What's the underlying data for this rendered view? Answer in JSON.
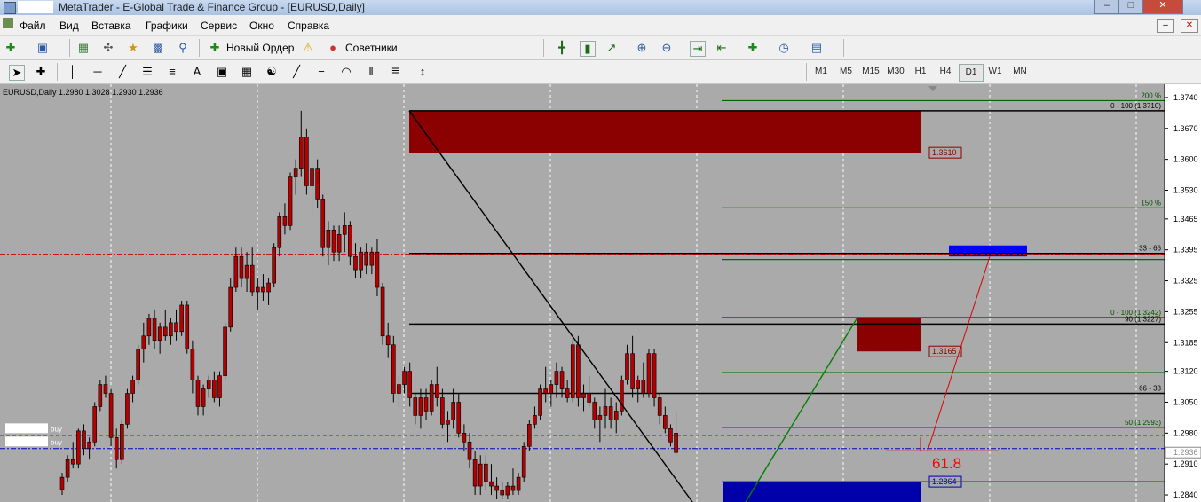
{
  "window": {
    "title": "MetaTrader - E-Global Trade & Finance Group - [EURUSD,Daily]"
  },
  "menu": [
    "Файл",
    "Вид",
    "Вставка",
    "Графики",
    "Сервис",
    "Окно",
    "Справка"
  ],
  "toolbar1": {
    "new_order": "Новый Ордер",
    "advisors": "Советники"
  },
  "timeframes": [
    "M1",
    "M5",
    "M15",
    "M30",
    "H1",
    "H4",
    "D1",
    "W1",
    "MN"
  ],
  "active_timeframe": "D1",
  "chart_data": {
    "type": "candlestick",
    "header": "EURUSD,Daily  1.2980 1.3028 1.2930 1.2936",
    "y_ticks": [
      "1.3740",
      "1.3670",
      "1.3600",
      "1.3530",
      "1.3465",
      "1.3395",
      "1.3325",
      "1.3255",
      "1.3185",
      "1.3120",
      "1.3050",
      "1.2980",
      "1.2910",
      "1.2840"
    ],
    "ylim": [
      1.2824,
      1.377
    ],
    "current_price": "1.2936",
    "zones": [
      {
        "label": "1.3610",
        "color": "#8b0000",
        "price_top": 1.371,
        "price_bottom": 1.3615
      },
      {
        "label": "1.3165",
        "color": "#8b0000",
        "price_top": 1.3242,
        "price_bottom": 1.3165
      },
      {
        "label": "1.2864",
        "color": "#0000aa",
        "price_top": 1.287,
        "price_bottom": 1.2824
      },
      {
        "label": "",
        "color": "#0000ff",
        "price_top": 1.3405,
        "price_bottom": 1.338
      }
    ],
    "levels": [
      {
        "label": "200 %",
        "price": 1.3733,
        "color": "#006400"
      },
      {
        "label": "0 - 100  (1.3710)",
        "price": 1.371,
        "color": "#000000"
      },
      {
        "label": "150 %",
        "price": 1.349,
        "color": "#006400"
      },
      {
        "label": "33 - 66",
        "price": 1.3387,
        "color": "#000000"
      },
      {
        "label": "",
        "price": 1.3373,
        "color": "#006400"
      },
      {
        "label": "0 - 100  (1.3242)",
        "price": 1.3242,
        "color": "#006400"
      },
      {
        "label": "90  (1.3227)",
        "price": 1.3227,
        "color": "#000000"
      },
      {
        "label": "",
        "price": 1.3117,
        "color": "#006400"
      },
      {
        "label": "66 - 33",
        "price": 1.307,
        "color": "#000000"
      },
      {
        "label": "50  (1.2993)",
        "price": 1.2993,
        "color": "#006400"
      },
      {
        "label": "",
        "price": 1.287,
        "color": "#006400"
      }
    ],
    "annotation": "61.8",
    "trade_labels": [
      "buy",
      "buy"
    ],
    "candles": [
      [
        1.2852,
        1.289,
        1.284,
        1.288
      ],
      [
        1.288,
        1.293,
        1.287,
        1.292
      ],
      [
        1.292,
        1.296,
        1.29,
        1.291
      ],
      [
        1.291,
        1.299,
        1.29,
        1.2985
      ],
      [
        1.2985,
        1.3,
        1.293,
        1.2945
      ],
      [
        1.2945,
        1.297,
        1.292,
        1.296
      ],
      [
        1.296,
        1.305,
        1.295,
        1.304
      ],
      [
        1.304,
        1.31,
        1.303,
        1.309
      ],
      [
        1.309,
        1.311,
        1.306,
        1.307
      ],
      [
        1.307,
        1.308,
        1.295,
        1.297
      ],
      [
        1.297,
        1.299,
        1.29,
        1.292
      ],
      [
        1.292,
        1.301,
        1.291,
        1.3
      ],
      [
        1.3,
        1.308,
        1.299,
        1.307
      ],
      [
        1.307,
        1.311,
        1.305,
        1.31
      ],
      [
        1.31,
        1.318,
        1.309,
        1.317
      ],
      [
        1.317,
        1.323,
        1.314,
        1.32
      ],
      [
        1.32,
        1.325,
        1.318,
        1.324
      ],
      [
        1.324,
        1.326,
        1.317,
        1.319
      ],
      [
        1.319,
        1.323,
        1.316,
        1.322
      ],
      [
        1.322,
        1.326,
        1.319,
        1.32
      ],
      [
        1.32,
        1.324,
        1.318,
        1.323
      ],
      [
        1.323,
        1.326,
        1.319,
        1.321
      ],
      [
        1.321,
        1.328,
        1.32,
        1.327
      ],
      [
        1.327,
        1.328,
        1.316,
        1.317
      ],
      [
        1.317,
        1.319,
        1.307,
        1.31
      ],
      [
        1.31,
        1.311,
        1.302,
        1.304
      ],
      [
        1.304,
        1.309,
        1.302,
        1.308
      ],
      [
        1.308,
        1.311,
        1.306,
        1.31
      ],
      [
        1.31,
        1.312,
        1.305,
        1.306
      ],
      [
        1.306,
        1.312,
        1.304,
        1.311
      ],
      [
        1.311,
        1.323,
        1.31,
        1.322
      ],
      [
        1.322,
        1.333,
        1.321,
        1.331
      ],
      [
        1.331,
        1.34,
        1.33,
        1.338
      ],
      [
        1.338,
        1.34,
        1.331,
        1.333
      ],
      [
        1.333,
        1.339,
        1.33,
        1.336
      ],
      [
        1.336,
        1.34,
        1.329,
        1.33
      ],
      [
        1.33,
        1.333,
        1.326,
        1.331
      ],
      [
        1.331,
        1.334,
        1.328,
        1.33
      ],
      [
        1.33,
        1.333,
        1.327,
        1.332
      ],
      [
        1.332,
        1.341,
        1.331,
        1.34
      ],
      [
        1.34,
        1.348,
        1.338,
        1.347
      ],
      [
        1.347,
        1.35,
        1.343,
        1.345
      ],
      [
        1.345,
        1.357,
        1.344,
        1.356
      ],
      [
        1.356,
        1.36,
        1.352,
        1.358
      ],
      [
        1.358,
        1.371,
        1.356,
        1.365
      ],
      [
        1.365,
        1.367,
        1.352,
        1.354
      ],
      [
        1.354,
        1.359,
        1.347,
        1.358
      ],
      [
        1.358,
        1.36,
        1.349,
        1.351
      ],
      [
        1.351,
        1.352,
        1.338,
        1.34
      ],
      [
        1.34,
        1.346,
        1.336,
        1.344
      ],
      [
        1.344,
        1.345,
        1.337,
        1.339
      ],
      [
        1.339,
        1.345,
        1.337,
        1.343
      ],
      [
        1.343,
        1.348,
        1.339,
        1.345
      ],
      [
        1.345,
        1.346,
        1.336,
        1.338
      ],
      [
        1.338,
        1.341,
        1.333,
        1.335
      ],
      [
        1.335,
        1.34,
        1.333,
        1.339
      ],
      [
        1.339,
        1.341,
        1.334,
        1.336
      ],
      [
        1.336,
        1.34,
        1.334,
        1.339
      ],
      [
        1.339,
        1.342,
        1.329,
        1.331
      ],
      [
        1.331,
        1.332,
        1.318,
        1.32
      ],
      [
        1.32,
        1.323,
        1.315,
        1.318
      ],
      [
        1.318,
        1.32,
        1.305,
        1.307
      ],
      [
        1.307,
        1.311,
        1.304,
        1.309
      ],
      [
        1.309,
        1.313,
        1.307,
        1.312
      ],
      [
        1.312,
        1.314,
        1.304,
        1.306
      ],
      [
        1.306,
        1.307,
        1.3,
        1.302
      ],
      [
        1.302,
        1.308,
        1.299,
        1.306
      ],
      [
        1.306,
        1.308,
        1.301,
        1.303
      ],
      [
        1.303,
        1.31,
        1.302,
        1.309
      ],
      [
        1.309,
        1.313,
        1.304,
        1.306
      ],
      [
        1.306,
        1.308,
        1.299,
        1.3
      ],
      [
        1.3,
        1.303,
        1.296,
        1.301
      ],
      [
        1.301,
        1.308,
        1.299,
        1.305
      ],
      [
        1.305,
        1.307,
        1.297,
        1.298
      ],
      [
        1.298,
        1.3,
        1.294,
        1.296
      ],
      [
        1.296,
        1.298,
        1.29,
        1.292
      ],
      [
        1.292,
        1.294,
        1.284,
        1.286
      ],
      [
        1.286,
        1.293,
        1.284,
        1.291
      ],
      [
        1.291,
        1.293,
        1.285,
        1.287
      ],
      [
        1.287,
        1.291,
        1.284,
        1.286
      ],
      [
        1.286,
        1.288,
        1.283,
        1.285
      ],
      [
        1.285,
        1.287,
        1.283,
        1.284
      ],
      [
        1.284,
        1.287,
        1.283,
        1.286
      ],
      [
        1.286,
        1.29,
        1.284,
        1.285
      ],
      [
        1.285,
        1.289,
        1.284,
        1.288
      ],
      [
        1.288,
        1.296,
        1.287,
        1.295
      ],
      [
        1.295,
        1.301,
        1.294,
        1.3
      ],
      [
        1.3,
        1.304,
        1.299,
        1.302
      ],
      [
        1.302,
        1.309,
        1.301,
        1.308
      ],
      [
        1.308,
        1.313,
        1.305,
        1.307
      ],
      [
        1.307,
        1.31,
        1.304,
        1.309
      ],
      [
        1.309,
        1.314,
        1.306,
        1.312
      ],
      [
        1.312,
        1.313,
        1.306,
        1.308
      ],
      [
        1.308,
        1.31,
        1.305,
        1.306
      ],
      [
        1.306,
        1.319,
        1.305,
        1.318
      ],
      [
        1.318,
        1.32,
        1.304,
        1.306
      ],
      [
        1.306,
        1.309,
        1.303,
        1.307
      ],
      [
        1.307,
        1.311,
        1.304,
        1.305
      ],
      [
        1.305,
        1.306,
        1.299,
        1.301
      ],
      [
        1.301,
        1.304,
        1.296,
        1.302
      ],
      [
        1.302,
        1.308,
        1.299,
        1.304
      ],
      [
        1.304,
        1.306,
        1.299,
        1.301
      ],
      [
        1.301,
        1.305,
        1.298,
        1.303
      ],
      [
        1.303,
        1.311,
        1.302,
        1.31
      ],
      [
        1.31,
        1.318,
        1.309,
        1.316
      ],
      [
        1.316,
        1.32,
        1.306,
        1.308
      ],
      [
        1.308,
        1.311,
        1.305,
        1.31
      ],
      [
        1.31,
        1.314,
        1.306,
        1.307
      ],
      [
        1.307,
        1.317,
        1.306,
        1.316
      ],
      [
        1.316,
        1.317,
        1.304,
        1.306
      ],
      [
        1.306,
        1.307,
        1.3,
        1.302
      ],
      [
        1.302,
        1.304,
        1.298,
        1.299
      ],
      [
        1.299,
        1.3,
        1.295,
        1.296
      ],
      [
        1.298,
        1.3028,
        1.293,
        1.2936
      ]
    ]
  }
}
